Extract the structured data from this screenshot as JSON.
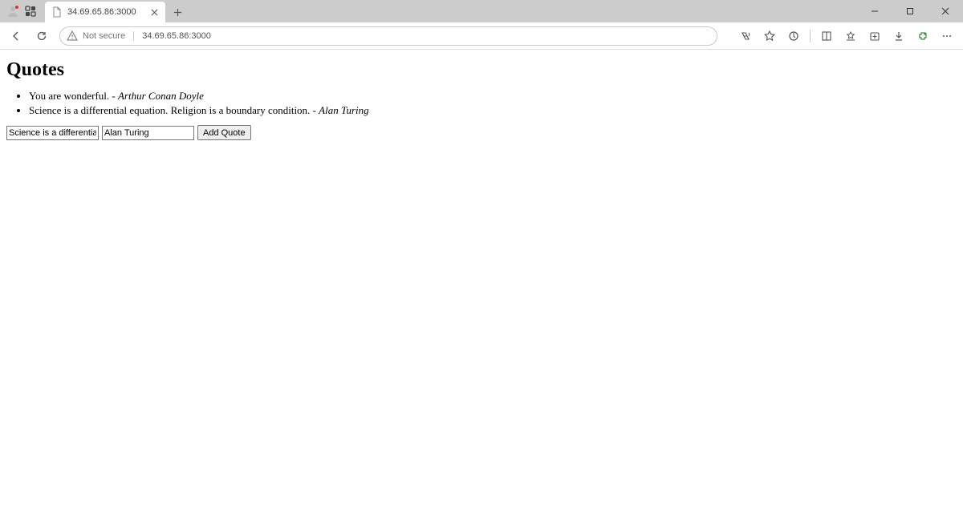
{
  "browser": {
    "tab_title": "34.69.65.86:3000",
    "not_secure_label": "Not secure",
    "url": "34.69.65.86:3000"
  },
  "page": {
    "heading": "Quotes",
    "quotes": [
      {
        "text": "You are wonderful.",
        "separator": " - ",
        "author": "Arthur Conan Doyle"
      },
      {
        "text": "Science is a differential equation. Religion is a boundary condition.",
        "separator": " - ",
        "author": "Alan Turing"
      }
    ],
    "form": {
      "quote_value": "Science is a differential equation",
      "author_value": "Alan Turing",
      "submit_label": "Add Quote"
    }
  }
}
